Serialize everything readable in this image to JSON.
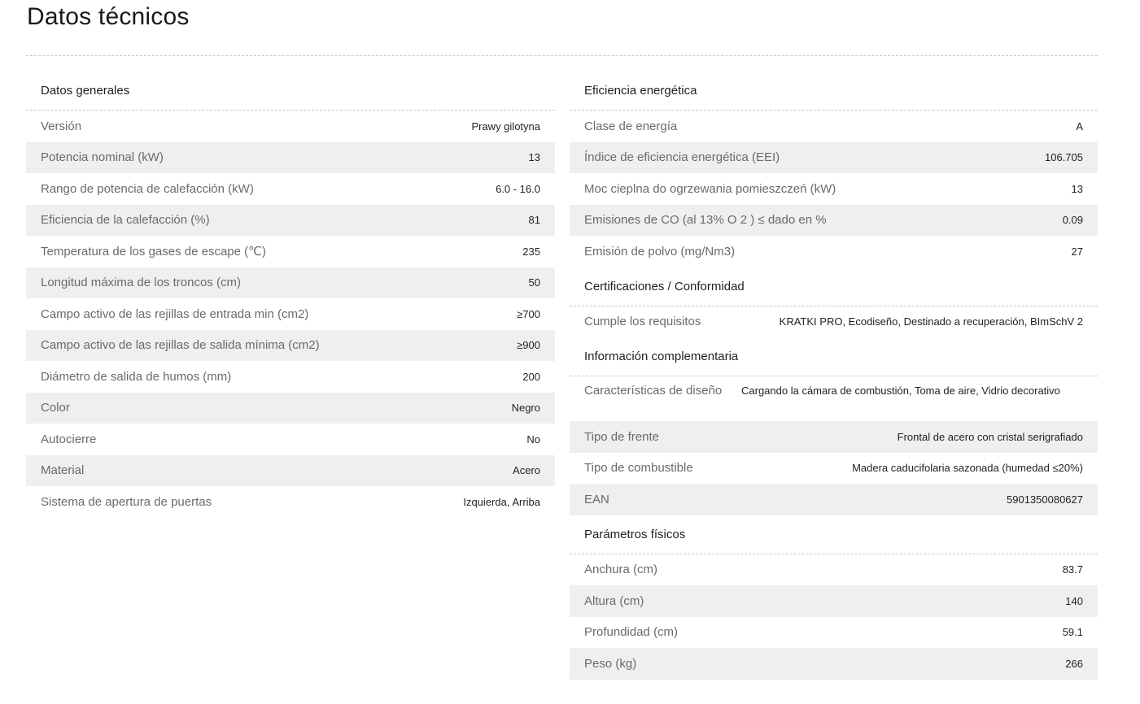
{
  "page": {
    "title": "Datos técnicos"
  },
  "sections": {
    "general": {
      "title": "Datos generales",
      "rows": [
        {
          "label": "Versión",
          "value": "Prawy gilotyna"
        },
        {
          "label": "Potencia nominal (kW)",
          "value": "13"
        },
        {
          "label": "Rango de potencia de calefacción (kW)",
          "value": "6.0 - 16.0"
        },
        {
          "label": "Eficiencia de la calefacción (%)",
          "value": "81"
        },
        {
          "label": "Temperatura de los gases de escape (℃)",
          "value": "235"
        },
        {
          "label": "Longitud máxima de los troncos (cm)",
          "value": "50"
        },
        {
          "label": "Campo activo de las rejillas de entrada min (cm2)",
          "value": "≥700"
        },
        {
          "label": "Campo activo de las rejillas de salida mínima (cm2)",
          "value": "≥900"
        },
        {
          "label": "Diámetro de salida de humos (mm)",
          "value": "200"
        },
        {
          "label": "Color",
          "value": "Negro"
        },
        {
          "label": "Autocierre",
          "value": "No"
        },
        {
          "label": "Material",
          "value": "Acero"
        },
        {
          "label": "Sistema de apertura de puertas",
          "value": "Izquierda, Arriba"
        }
      ]
    },
    "energy": {
      "title": "Eficiencia energética",
      "rows": [
        {
          "label": "Clase de energía",
          "value": "A"
        },
        {
          "label": "Índice de eficiencia energética (EEI)",
          "value": "106.705"
        },
        {
          "label": "Moc cieplna do ogrzewania pomieszczeń (kW)",
          "value": "13"
        },
        {
          "label": "Emisiones de CO (al 13% O 2 ) ≤ dado en %",
          "value": "0.09"
        },
        {
          "label": "Emisión de polvo (mg/Nm3)",
          "value": "27"
        }
      ]
    },
    "certifications": {
      "title": "Certificaciones / Conformidad",
      "rows": [
        {
          "label": "Cumple los requisitos",
          "value": "KRATKI PRO, Ecodiseño, Destinado a recuperación, BImSchV 2"
        }
      ]
    },
    "complementary": {
      "title": "Información complementaria",
      "rows": [
        {
          "label": "Características de diseño",
          "value": "Cargando la cámara de combustión, Toma de aire, Vidrio decorativo"
        },
        {
          "label": "Tipo de frente",
          "value": "Frontal de acero con cristal serigrafiado"
        },
        {
          "label": "Tipo de combustible",
          "value": "Madera caducifolaria sazonada (humedad ≤20%)"
        },
        {
          "label": "EAN",
          "value": "5901350080627"
        }
      ]
    },
    "physical": {
      "title": "Parámetros físicos",
      "rows": [
        {
          "label": "Anchura (cm)",
          "value": "83.7"
        },
        {
          "label": "Altura (cm)",
          "value": "140"
        },
        {
          "label": "Profundidad (cm)",
          "value": "59.1"
        },
        {
          "label": "Peso (kg)",
          "value": "266"
        }
      ]
    }
  }
}
